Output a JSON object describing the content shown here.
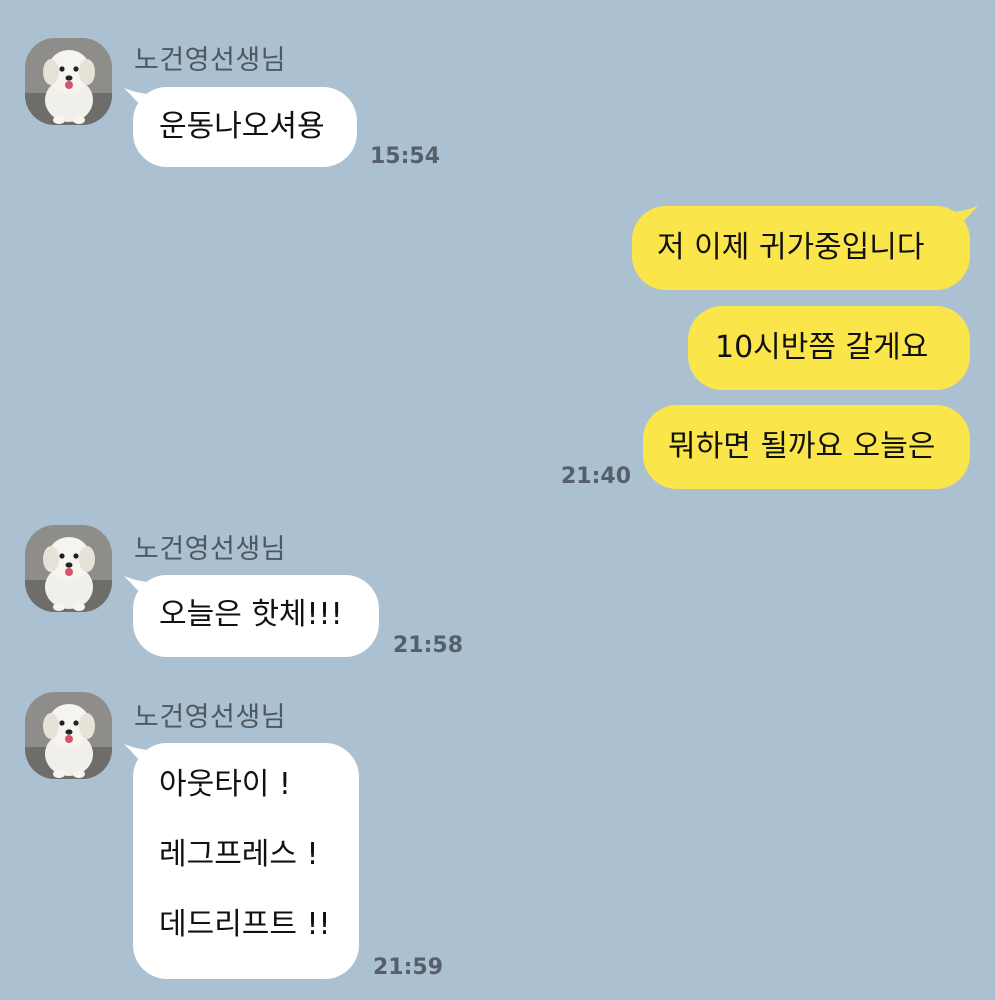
{
  "conversation": {
    "sender_name": "노건영선생님",
    "messages": [
      {
        "direction": "incoming",
        "text": "운동나오셔용",
        "time": "15:54"
      },
      {
        "direction": "outgoing",
        "text": "저 이제 귀가중입니다"
      },
      {
        "direction": "outgoing",
        "text": "10시반쯤 갈게요"
      },
      {
        "direction": "outgoing",
        "text": "뭐하면 될까요 오늘은",
        "time": "21:40"
      },
      {
        "direction": "incoming",
        "text": "오늘은 핫체!!!",
        "time": "21:58"
      },
      {
        "direction": "incoming",
        "lines": [
          "아웃타이 !",
          "레그프레스 !",
          "데드리프트 !!"
        ],
        "time": "21:59"
      }
    ]
  },
  "colors": {
    "background": "#abc1d1",
    "incoming_bubble": "#ffffff",
    "outgoing_bubble": "#fae64b",
    "timestamp": "#55606a",
    "sender_name": "#4f5860"
  }
}
